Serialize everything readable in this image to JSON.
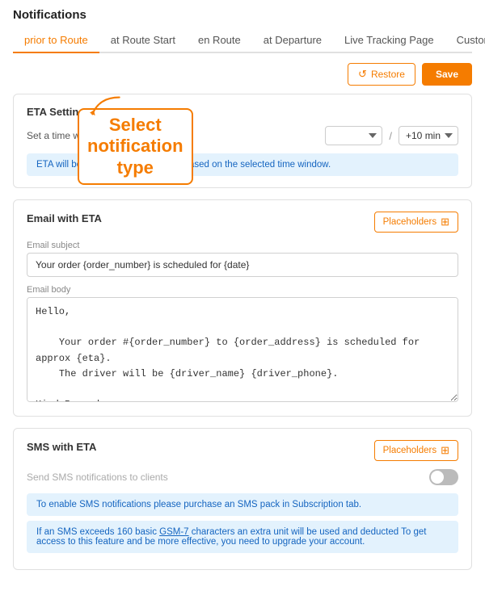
{
  "page": {
    "title": "Notifications"
  },
  "tabs": [
    {
      "id": "prior-to-route",
      "label": "prior to Route",
      "active": true
    },
    {
      "id": "at-route-start",
      "label": "at Route Start",
      "active": false
    },
    {
      "id": "en-route",
      "label": "en Route",
      "active": false
    },
    {
      "id": "at-departure",
      "label": "at Departure",
      "active": false
    },
    {
      "id": "live-tracking-page",
      "label": "Live Tracking Page",
      "active": false
    },
    {
      "id": "custom",
      "label": "Custom",
      "active": false
    }
  ],
  "toolbar": {
    "restore_label": "Restore",
    "save_label": "Save"
  },
  "eta_settings": {
    "title": "ETA Settings",
    "label": "Set a time window for ETA",
    "select1_value": "",
    "select2_value": "+10 min",
    "info_text": "ETA will be displayed as an interval based on the selected time window."
  },
  "annotation": {
    "text": "Select\nnotification\ntype"
  },
  "email_eta": {
    "title": "Email with ETA",
    "placeholder_label": "Placeholders",
    "subject_label": "Email subject",
    "subject_value": "Your order {order_number} is scheduled for {date}",
    "body_label": "Email body",
    "body_value": "Hello,\n\n    Your order #{order_number} to {order_address} is scheduled for approx {eta}.\n    The driver will be {driver_name} {driver_phone}.\n\nKind Regards,\nThe Sales Team\n\n___\n\nTrack-POD is the real-time routing and tracking software we use at our company.\nhttps://www.track-pod.com"
  },
  "sms_eta": {
    "title": "SMS with ETA",
    "placeholder_label": "Placeholders",
    "toggle_label": "Send SMS notifications to clients",
    "toggle_on": false,
    "info1": "To enable SMS notifications please purchase an SMS pack in Subscription tab.",
    "info2": "If an SMS exceeds 160 basic GSM-7 characters an extra unit will be used and deducted To get access to this feature and be more effective, you need to upgrade your account."
  }
}
